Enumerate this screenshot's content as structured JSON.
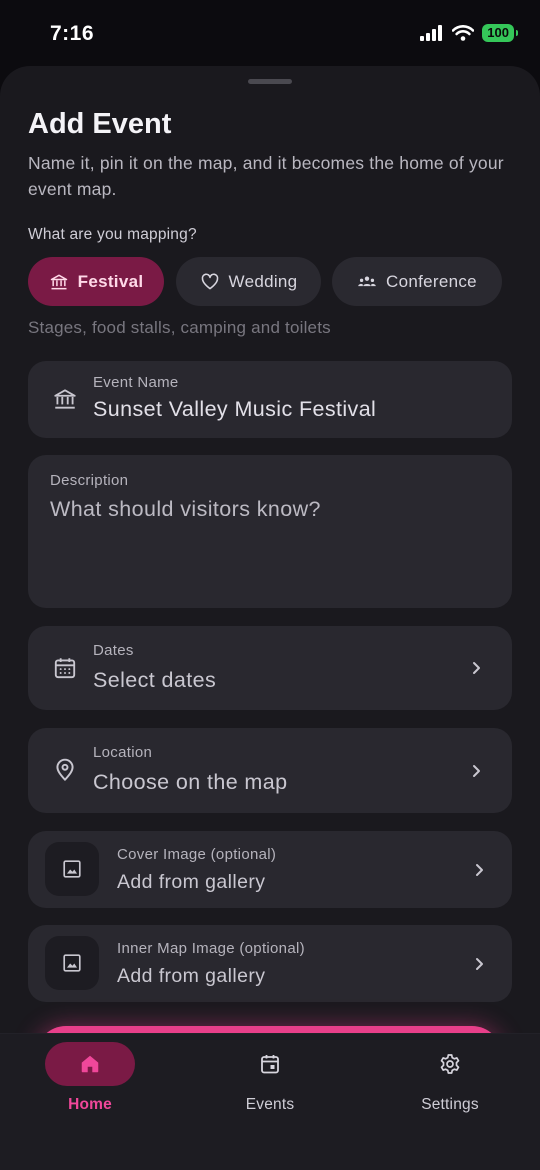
{
  "status_bar": {
    "time": "7:16",
    "battery": "100"
  },
  "header": {
    "title": "Add Event",
    "subtitle": "Name it, pin it on the map, and it becomes the home of your event map."
  },
  "category": {
    "label": "What are you mapping?",
    "chips": [
      {
        "label": "Festival",
        "icon": "bank-icon",
        "selected": true
      },
      {
        "label": "Wedding",
        "icon": "heart-icon",
        "selected": false
      },
      {
        "label": "Conference",
        "icon": "people-icon",
        "selected": false
      }
    ],
    "hint": "Stages, food stalls, camping and toilets"
  },
  "fields": {
    "event_name": {
      "label": "Event Name",
      "value": "Sunset Valley Music Festival"
    },
    "description": {
      "label": "Description",
      "placeholder": "What should visitors know?"
    },
    "dates": {
      "label": "Dates",
      "value": "Select dates"
    },
    "location": {
      "label": "Location",
      "value": "Choose on the map"
    },
    "cover_image": {
      "label": "Cover Image (optional)",
      "value": "Add from gallery"
    },
    "inner_map_image": {
      "label": "Inner Map Image (optional)",
      "value": "Add from gallery"
    }
  },
  "bottom_nav": {
    "items": [
      {
        "label": "Home",
        "icon": "home-icon",
        "active": true
      },
      {
        "label": "Events",
        "icon": "calendar-event-icon",
        "active": false
      },
      {
        "label": "Settings",
        "icon": "gear-icon",
        "active": false
      }
    ]
  },
  "colors": {
    "accent": "#e83f8a",
    "accent_dark": "#7a1a45",
    "surface": "#29282f",
    "background": "#1a191e"
  }
}
